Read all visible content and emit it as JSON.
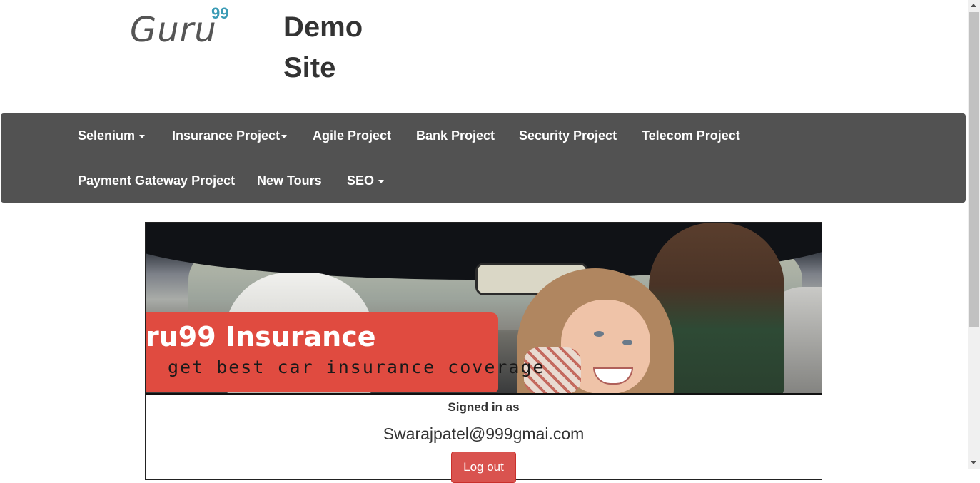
{
  "header": {
    "logo_text": "Guru",
    "logo_superscript": "99",
    "site_title": "Demo Site"
  },
  "navbar": {
    "items": [
      {
        "label": "Selenium",
        "dropdown": true
      },
      {
        "label": "Insurance Project",
        "dropdown": true
      },
      {
        "label": "Agile Project",
        "dropdown": false
      },
      {
        "label": "Bank Project",
        "dropdown": false
      },
      {
        "label": "Security Project",
        "dropdown": false
      },
      {
        "label": "Telecom Project",
        "dropdown": false
      },
      {
        "label": "Payment Gateway Project",
        "dropdown": false
      },
      {
        "label": "New Tours",
        "dropdown": false
      },
      {
        "label": "SEO",
        "dropdown": true
      }
    ]
  },
  "banner": {
    "title": "ru99 Insurance",
    "subtitle": "get best car insurance coverage"
  },
  "account": {
    "signed_in_label": "Signed in as",
    "email": "Swarajpatel@999gmai.com",
    "logout_label": "Log out"
  },
  "colors": {
    "navbar_bg": "#525252",
    "logout_button": "#d9534f",
    "banner_ribbon": "#e04b40",
    "logo_accent": "#3b9bb5"
  }
}
